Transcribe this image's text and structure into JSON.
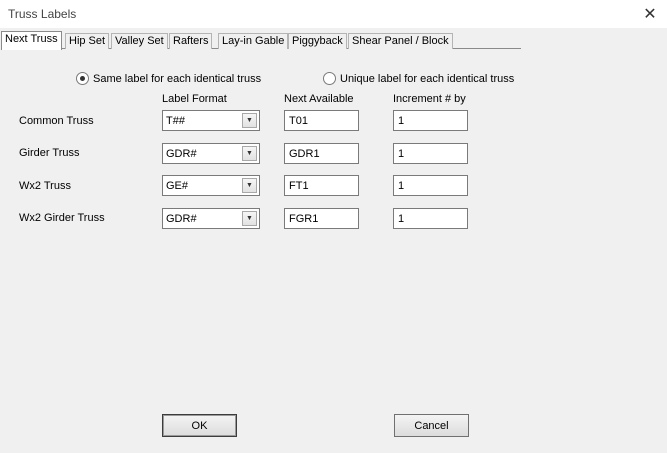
{
  "window": {
    "title": "Truss Labels",
    "close_icon": "close-icon"
  },
  "tabs": [
    {
      "label": "Next Truss",
      "active": true
    },
    {
      "label": "Hip Set"
    },
    {
      "label": "Valley Set"
    },
    {
      "label": "Rafters"
    },
    {
      "label": "Lay-in Gable"
    },
    {
      "label": "Piggyback"
    },
    {
      "label": "Shear Panel / Block"
    }
  ],
  "label_mode": {
    "options": [
      {
        "label": "Same label for each identical truss",
        "selected": true
      },
      {
        "label": "Unique label for each identical truss",
        "selected": false
      }
    ]
  },
  "columns": {
    "label_format": "Label Format",
    "next_available": "Next Available",
    "increment": "Increment # by"
  },
  "rows": [
    {
      "name": "Common Truss",
      "format": "T##",
      "next": "T01",
      "increment": "1"
    },
    {
      "name": "Girder Truss",
      "format": "GDR#",
      "next": "GDR1",
      "increment": "1"
    },
    {
      "name": "Wx2 Truss",
      "format": "GE#",
      "next": "FT1",
      "increment": "1"
    },
    {
      "name": "Wx2 Girder Truss",
      "format": "GDR#",
      "next": "FGR1",
      "increment": "1"
    }
  ],
  "buttons": {
    "ok": "OK",
    "cancel": "Cancel"
  }
}
